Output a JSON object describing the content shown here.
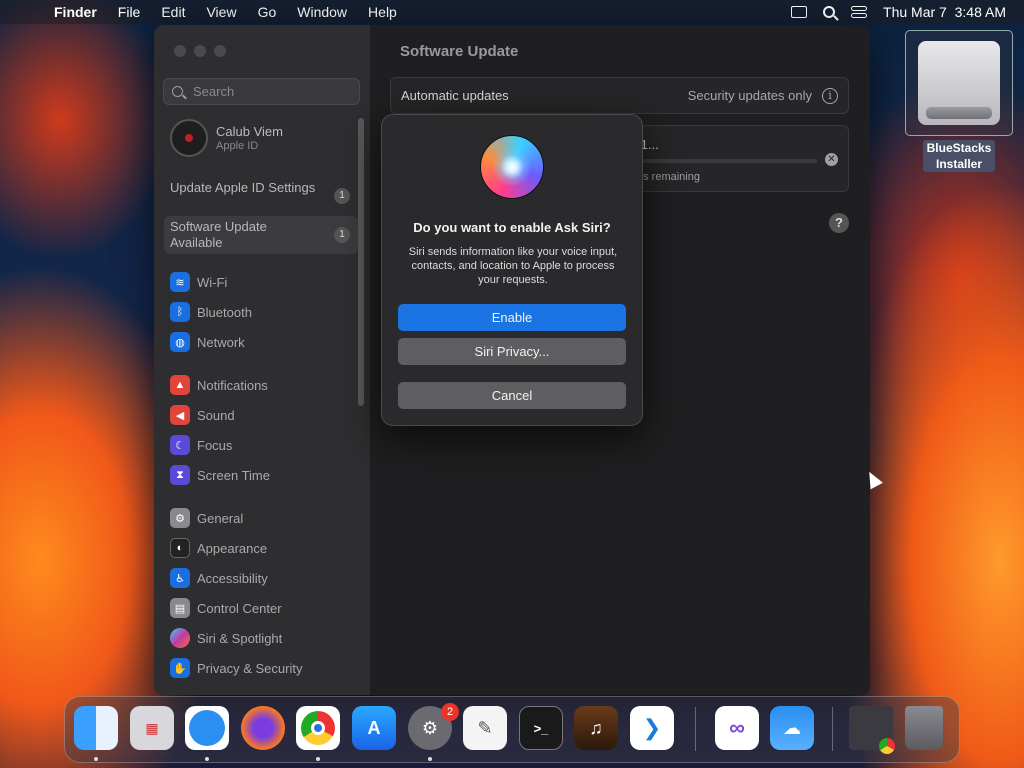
{
  "menubar": {
    "app": "Finder",
    "menus": [
      "File",
      "Edit",
      "View",
      "Go",
      "Window",
      "Help"
    ],
    "datetime": "Thu Mar 7  3:48 AM"
  },
  "sidebar": {
    "search_placeholder": "Search",
    "user_name": "Calub Viem",
    "user_sub": "Apple ID",
    "rows": [
      {
        "label": "Update Apple ID Settings",
        "badge": "1"
      },
      {
        "label": "Software Update Available",
        "badge": "1"
      }
    ],
    "items": [
      {
        "label": "Wi-Fi",
        "icon": "wifi-icon",
        "color": "#1a6fe0"
      },
      {
        "label": "Bluetooth",
        "icon": "bluetooth-icon",
        "color": "#1a6fe0"
      },
      {
        "label": "Network",
        "icon": "globe-icon",
        "color": "#1a6fe0"
      },
      {
        "label": "Notifications",
        "icon": "bell-icon",
        "color": "#e0443a"
      },
      {
        "label": "Sound",
        "icon": "speaker-icon",
        "color": "#e0443a"
      },
      {
        "label": "Focus",
        "icon": "moon-icon",
        "color": "#5a4ad8"
      },
      {
        "label": "Screen Time",
        "icon": "hourglass-icon",
        "color": "#5a4ad8"
      },
      {
        "label": "General",
        "icon": "gear-icon",
        "color": "#8a8a8e"
      },
      {
        "label": "Appearance",
        "icon": "appearance-icon",
        "color": "#222"
      },
      {
        "label": "Accessibility",
        "icon": "accessibility-icon",
        "color": "#1a6fe0"
      },
      {
        "label": "Control Center",
        "icon": "control-center-icon",
        "color": "#8a8a8e"
      },
      {
        "label": "Siri & Spotlight",
        "icon": "siri-icon",
        "color": "#c03aa0"
      },
      {
        "label": "Privacy & Security",
        "icon": "hand-icon",
        "color": "#1a6fe0"
      }
    ]
  },
  "content": {
    "title": "Software Update",
    "auto_label": "Automatic updates",
    "auto_value": "Security updates only",
    "update_version": ".1...",
    "update_remaining": "ds remaining"
  },
  "dialog": {
    "question": "Do you want to enable Ask Siri?",
    "description": "Siri sends information like your voice input, contacts, and location to Apple to process your requests.",
    "enable": "Enable",
    "privacy": "Siri Privacy...",
    "cancel": "Cancel"
  },
  "desktop": {
    "drive_label": "BlueStacks Installer"
  },
  "dock": {
    "settings_badge": "2",
    "apps": [
      "Finder",
      "Launchpad",
      "Safari",
      "Firefox",
      "Chrome",
      "App Store",
      "System Settings",
      "TextEdit",
      "Terminal",
      "GarageBand",
      "VS Code",
      "Visual Studio",
      "Weather",
      "Downloads",
      "Trash"
    ]
  }
}
